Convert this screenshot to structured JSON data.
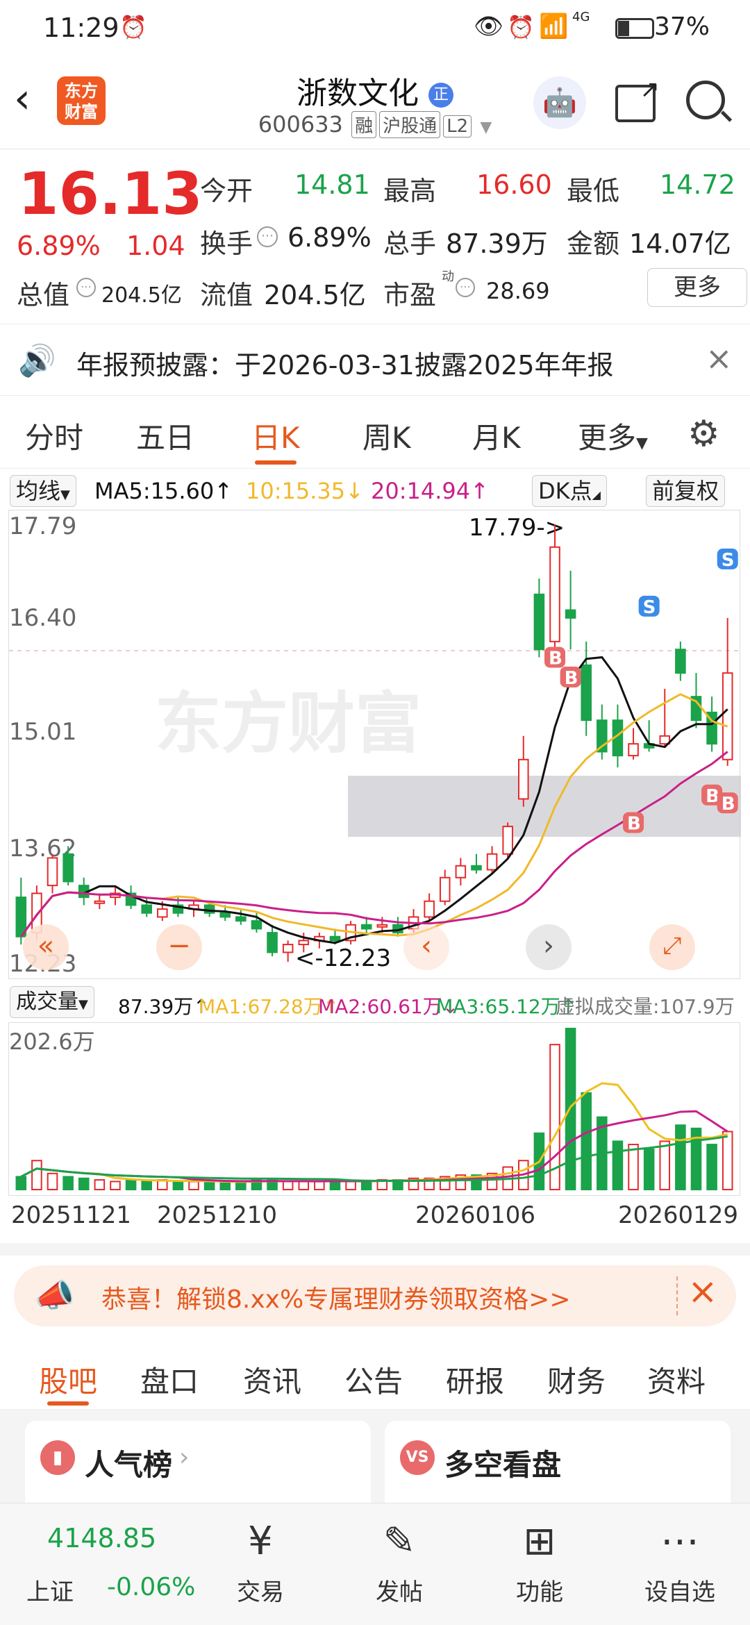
{
  "status": {
    "time": "11:29",
    "battery": "37%",
    "network": "4G"
  },
  "header": {
    "logo_text": "东方财富",
    "title": "浙数文化",
    "title_badge": "正",
    "code": "600633",
    "tags": [
      "融",
      "沪股通",
      "L2"
    ]
  },
  "quote": {
    "price": "16.13",
    "change_pct": "6.89%",
    "change": "1.04",
    "open_label": "今开",
    "open": "14.81",
    "high_label": "最高",
    "high": "16.60",
    "low_label": "最低",
    "low": "14.72",
    "turnover_label": "换手",
    "turnover": "6.89%",
    "volume_label": "总手",
    "volume": "87.39万",
    "amount_label": "金额",
    "amount": "14.07亿",
    "mktcap_label": "总值",
    "mktcap": "204.5亿",
    "float_label": "流值",
    "float": "204.5亿",
    "pe_label": "市盈",
    "pe_sup": "动",
    "pe": "28.69",
    "more": "更多"
  },
  "notice": {
    "text": "年报预披露：于2026-03-31披露2025年年报"
  },
  "ktabs": [
    "分时",
    "五日",
    "日K",
    "周K",
    "月K",
    "更多"
  ],
  "ma": {
    "selector": "均线",
    "ma5": "MA5:15.60↑",
    "ma10": "10:15.35↓",
    "ma20": "20:14.94↑",
    "dk": "DK点",
    "adjust": "前复权"
  },
  "chart_labels": {
    "y": [
      "17.79",
      "16.40",
      "15.01",
      "13.62",
      "12.23"
    ],
    "high_mark": "17.79->",
    "low_mark": "<-12.23",
    "watermark": "东方财富"
  },
  "vol": {
    "selector": "成交量",
    "value": "87.39万↑",
    "ma1": "MA1:67.28万↑",
    "ma2": "MA2:60.61万↓",
    "ma3": "MA3:65.12万↑",
    "virtual": "虚拟成交量:107.9万",
    "ymax": "202.6万"
  },
  "dates": [
    "20251121",
    "20251210",
    "20260106",
    "20260129"
  ],
  "banner": {
    "text": "恭喜！解锁8.xx%专属理财券领取资格>>"
  },
  "btabs": [
    "股吧",
    "盘口",
    "资讯",
    "公告",
    "研报",
    "财务",
    "资料"
  ],
  "cards": {
    "left": "人气榜",
    "right": "多空看盘"
  },
  "bottom_nav": {
    "index_value": "4148.85",
    "index_name": "上证",
    "index_change": "-0.06%",
    "items": [
      "交易",
      "发帖",
      "功能",
      "设自选"
    ]
  },
  "colors": {
    "up": "#e52a2a",
    "down": "#1aa34a",
    "accent": "#e5591e",
    "ma5": "#111111",
    "ma10": "#f0b92a",
    "ma20": "#c8208a"
  },
  "chart_data": {
    "type": "candlestick",
    "x": [
      "20251121",
      "20251210",
      "20260106",
      "20260129"
    ],
    "ylim": [
      12.23,
      17.79
    ],
    "series": [
      {
        "name": "MA5",
        "last": 15.6
      },
      {
        "name": "MA10",
        "last": 15.35
      },
      {
        "name": "MA20",
        "last": 14.94
      }
    ],
    "volume_ylim": [
      0,
      202.6
    ]
  }
}
